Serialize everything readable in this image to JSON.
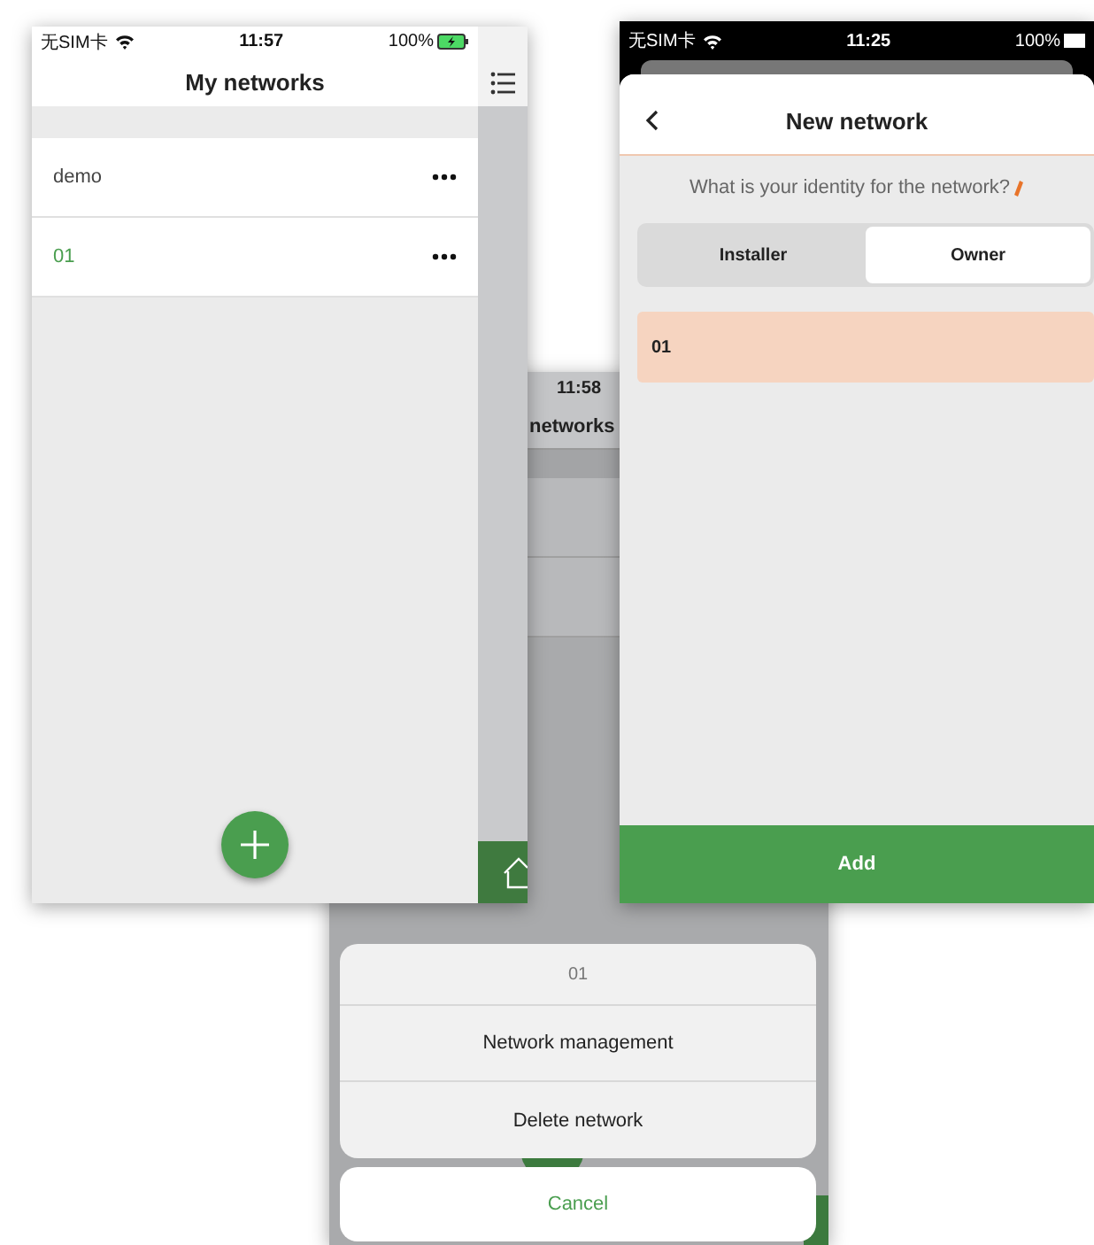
{
  "my_networks": {
    "status": {
      "carrier": "无SIM卡",
      "time": "11:57",
      "battery": "100%"
    },
    "title": "My networks",
    "networks": [
      {
        "name": "demo",
        "selected": false
      },
      {
        "name": "01",
        "selected": true
      }
    ]
  },
  "background_screen": {
    "time": "11:58",
    "title": "networks"
  },
  "new_network": {
    "status": {
      "carrier": "无SIM卡",
      "time": "11:25",
      "battery": "100%"
    },
    "title": "New network",
    "prompt": "What is your identity for the network?",
    "identity_options": [
      {
        "label": "Installer",
        "selected": false
      },
      {
        "label": "Owner",
        "selected": true
      }
    ],
    "name_field": {
      "value": "01"
    },
    "add_button": "Add"
  },
  "action_sheet": {
    "title": "01",
    "actions": [
      "Network management",
      "Delete network"
    ],
    "cancel": "Cancel"
  }
}
